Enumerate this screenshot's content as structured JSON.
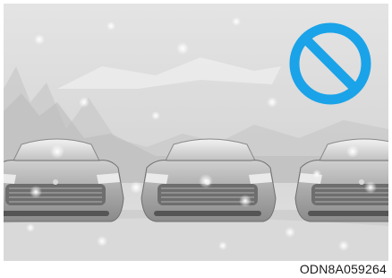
{
  "figure": {
    "code": "ODN8A059264",
    "prohibition_icon": "no-symbol-icon",
    "prohibition_color": "#1aa3e8",
    "scene": "cars-in-snow"
  }
}
